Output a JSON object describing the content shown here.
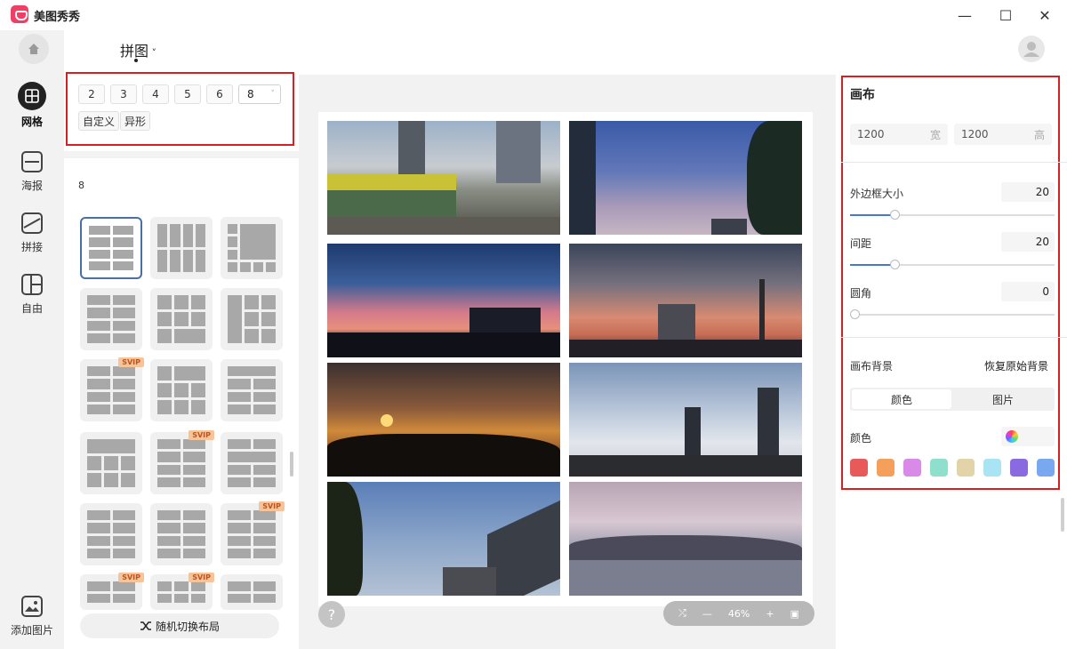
{
  "app": {
    "title": "美图秀秀"
  },
  "window_controls": {
    "minimize": "—",
    "maximize": "☐",
    "close": "✕"
  },
  "header": {
    "tool_title": "拼图"
  },
  "nav": {
    "items": [
      {
        "label": "网格",
        "icon": "grid-icon",
        "active": true
      },
      {
        "label": "海报",
        "icon": "poster-icon",
        "active": false
      },
      {
        "label": "拼接",
        "icon": "stitch-icon",
        "active": false
      },
      {
        "label": "自由",
        "icon": "free-layout-icon",
        "active": false
      }
    ],
    "add_image": "添加图片"
  },
  "layout_panel": {
    "counts": [
      "2",
      "3",
      "4",
      "5",
      "6"
    ],
    "selected_count": "8",
    "tags": [
      "自定义",
      "异形"
    ],
    "section_label": "8",
    "svip_badge": "SVIP",
    "shuffle_label": "随机切换布局"
  },
  "canvas": {
    "photos": [
      {
        "label": "city-street-bus"
      },
      {
        "label": "sky-with-trees"
      },
      {
        "label": "sunset-clouds-building"
      },
      {
        "label": "sunset-tower"
      },
      {
        "label": "sunset-silhouette-trees"
      },
      {
        "label": "clouds-skyscrapers"
      },
      {
        "label": "plane-sky-building"
      },
      {
        "label": "sea-mountain-mist"
      }
    ],
    "help": "?",
    "zoom": "46%"
  },
  "right_panel": {
    "title": "画布",
    "width": {
      "value": "1200",
      "unit": "宽"
    },
    "height": {
      "value": "1200",
      "unit": "高"
    },
    "outer_border": {
      "label": "外边框大小",
      "value": "20"
    },
    "spacing": {
      "label": "间距",
      "value": "20"
    },
    "corner": {
      "label": "圆角",
      "value": "0"
    },
    "background_label": "画布背景",
    "reset_background": "恢复原始背景",
    "tabs": {
      "color": "颜色",
      "image": "图片"
    },
    "color_label": "颜色",
    "swatches": [
      "#e85a5a",
      "#f4a05a",
      "#d98ae8",
      "#8ee0cc",
      "#e2d4a8",
      "#a8e4f4",
      "#8a6ae0",
      "#7aa8f0"
    ]
  }
}
